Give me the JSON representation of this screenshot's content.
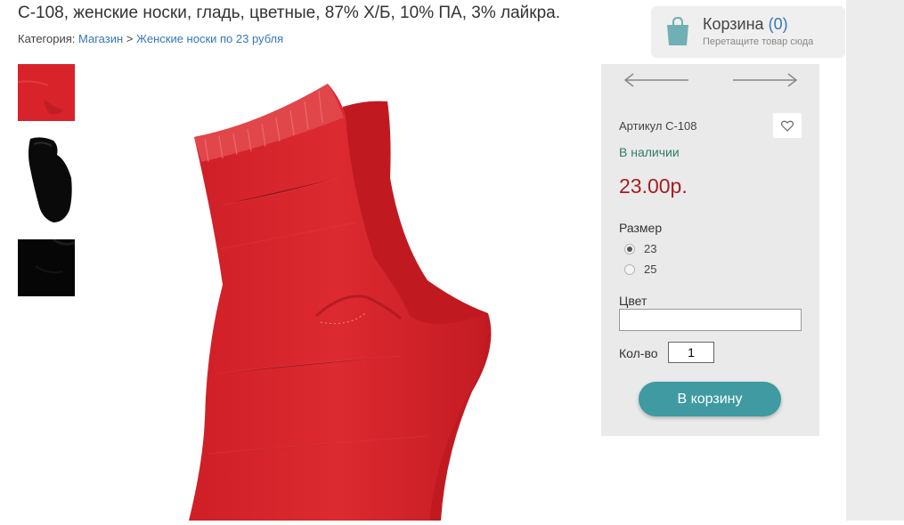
{
  "product": {
    "title": "С-108, женские носки, гладь, цветные, 87% Х/Б, 10% ПА, 3% лайкра.",
    "sku": "Артикул С-108",
    "stock": "В наличии",
    "price": "23.00р."
  },
  "breadcrumb": {
    "prefix": "Категория:",
    "link1": "Магазин",
    "separator": " > ",
    "link2": "Женские носки по 23 рубля"
  },
  "thumbnails": [
    {
      "color": "#d8232a",
      "label": "red-sock"
    },
    {
      "color": "#0a0a0a",
      "label": "black-short-sock"
    },
    {
      "color": "#060606",
      "label": "black-sock"
    }
  ],
  "cart": {
    "title": "Корзина",
    "count": "(0)",
    "hint": "Перетащите товар сюда"
  },
  "options": {
    "size_label": "Размер",
    "sizes": [
      {
        "label": "23",
        "checked": true
      },
      {
        "label": "25",
        "checked": false
      }
    ],
    "color_label": "Цвет",
    "color_value": "",
    "qty_label": "Кол-во",
    "qty_value": "1"
  },
  "actions": {
    "add_to_cart": "В корзину"
  },
  "colors": {
    "link": "#3478b8",
    "price": "#a31f24",
    "stock": "#2e7d6a",
    "button": "#3f9aa1",
    "panel": "#eaeaea",
    "sock": "#d8232a"
  }
}
